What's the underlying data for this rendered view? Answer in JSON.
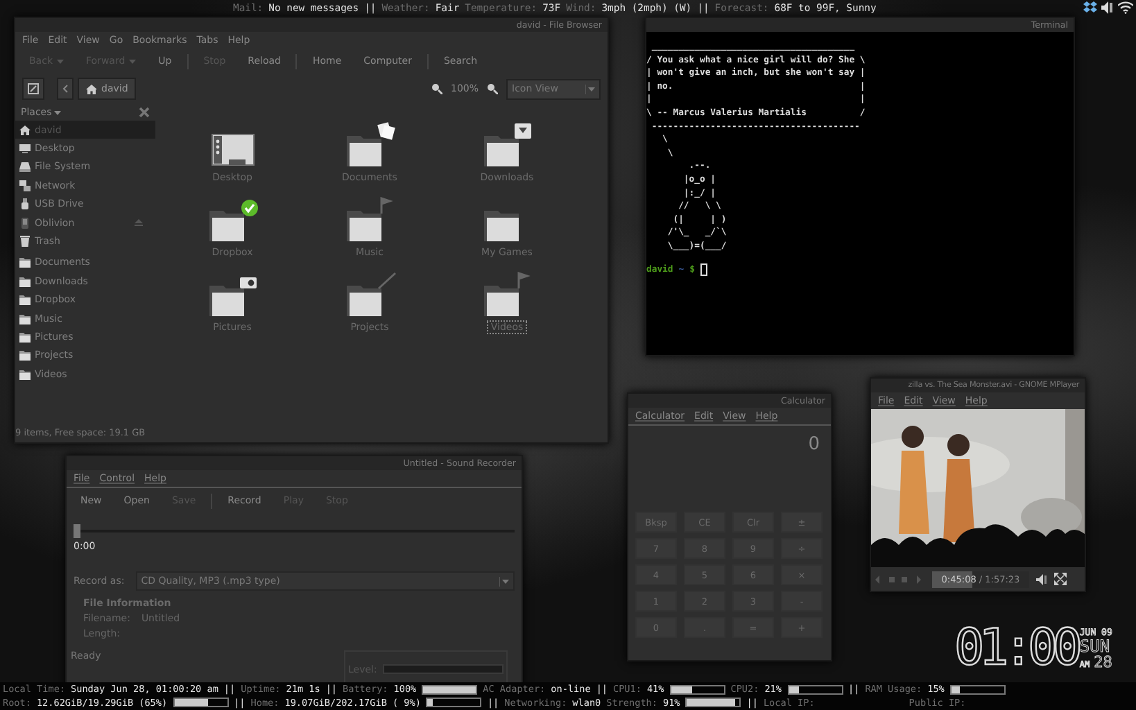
{
  "top_bar": {
    "items": [
      {
        "kind": "label",
        "text": "Mail:"
      },
      {
        "kind": "value",
        "text": "No new messages"
      },
      {
        "kind": "sep",
        "text": "||"
      },
      {
        "kind": "label",
        "text": "Weather:"
      },
      {
        "kind": "value",
        "text": "Fair"
      },
      {
        "kind": "label",
        "text": "Temperature:"
      },
      {
        "kind": "value",
        "text": "73F"
      },
      {
        "kind": "label",
        "text": "Wind:"
      },
      {
        "kind": "value",
        "text": "3mph (2mph) (W)"
      },
      {
        "kind": "sep",
        "text": "||"
      },
      {
        "kind": "label",
        "text": "Forecast:"
      },
      {
        "kind": "value",
        "text": "68F to 99F, Sunny"
      }
    ]
  },
  "file_browser": {
    "title": "david - File Browser",
    "menus": [
      "File",
      "Edit",
      "View",
      "Go",
      "Bookmarks",
      "Tabs",
      "Help"
    ],
    "toolbar": [
      {
        "label": "Back",
        "disabled": true,
        "kind": "dropdown"
      },
      {
        "label": "Forward",
        "disabled": true,
        "kind": "dropdown"
      },
      {
        "label": "Up",
        "disabled": false,
        "kind": "plain"
      },
      {
        "kind": "separator"
      },
      {
        "label": "Stop",
        "disabled": true,
        "kind": "plain"
      },
      {
        "label": "Reload",
        "disabled": false,
        "kind": "plain"
      },
      {
        "kind": "separator"
      },
      {
        "label": "Home",
        "disabled": false,
        "kind": "plain"
      },
      {
        "label": "Computer",
        "disabled": false,
        "kind": "plain"
      },
      {
        "kind": "separator"
      },
      {
        "label": "Search",
        "disabled": false,
        "kind": "plain"
      }
    ],
    "path": "david",
    "zoom": "100%",
    "view_mode": "Icon View",
    "sidebar": {
      "header": "Places",
      "items": [
        {
          "label": "david",
          "selected": true
        },
        {
          "label": "Desktop",
          "selected": false
        },
        {
          "label": "File System",
          "selected": false
        },
        {
          "label": "Network",
          "selected": false
        },
        {
          "label": "USB Drive",
          "selected": false
        },
        {
          "label": "Oblivion",
          "selected": false
        },
        {
          "label": "Trash",
          "selected": false
        },
        {
          "label": "Documents",
          "selected": false
        },
        {
          "label": "Downloads",
          "selected": false
        },
        {
          "label": "Dropbox",
          "selected": false
        },
        {
          "label": "Music",
          "selected": false
        },
        {
          "label": "Pictures",
          "selected": false
        },
        {
          "label": "Projects",
          "selected": false
        },
        {
          "label": "Videos",
          "selected": false
        }
      ]
    },
    "files": [
      {
        "label": "Desktop",
        "selected": false
      },
      {
        "label": "Documents",
        "selected": false
      },
      {
        "label": "Downloads",
        "selected": false
      },
      {
        "label": "Dropbox",
        "selected": false
      },
      {
        "label": "Music",
        "selected": false
      },
      {
        "label": "My Games",
        "selected": false
      },
      {
        "label": "Pictures",
        "selected": false
      },
      {
        "label": "Projects",
        "selected": false
      },
      {
        "label": "Videos",
        "selected": true
      }
    ],
    "status": "9 items, Free space: 19.1 GB"
  },
  "terminal": {
    "title": "Terminal",
    "output_lines": [
      " ______________________________________",
      "/ You ask what a nice girl will do? She \\",
      "| won't give an inch, but she won't say |",
      "| no.                                   |",
      "|                                       |",
      "\\ -- Marcus Valerius Martialis          /",
      " ---------------------------------------",
      "   \\",
      "    \\",
      "        .--.",
      "       |o_o |",
      "       |:_/ |",
      "      //   \\ \\",
      "     (|     | )",
      "    /'\\_   _/`\\",
      "    \\___)=(___/"
    ],
    "prompt": {
      "user": "david",
      "dir": "~",
      "symbol": "$"
    }
  },
  "sound_recorder": {
    "title": "Untitled - Sound Recorder",
    "menus": [
      "File",
      "Control",
      "Help"
    ],
    "toolbar": [
      {
        "label": "New",
        "disabled": false
      },
      {
        "label": "Open",
        "disabled": false
      },
      {
        "label": "Save",
        "disabled": true
      },
      {
        "label": "Record",
        "disabled": false
      },
      {
        "label": "Play",
        "disabled": true
      },
      {
        "label": "Stop",
        "disabled": true
      }
    ],
    "position": {
      "level": 0
    },
    "time": "0:00",
    "record_as_label": "Record as:",
    "record_as_value": "CD Quality, MP3 (.mp3 type)",
    "info_title": "File Information",
    "info": [
      {
        "label": "Filename:",
        "value": "Untitled"
      },
      {
        "label": "Length:"
      }
    ],
    "status": "Ready",
    "level_label": "Level:",
    "input_level": {
      "level": 0
    }
  },
  "calculator": {
    "title": "Calculator",
    "menus": [
      "Calculator",
      "Edit",
      "View",
      "Help"
    ],
    "display": "0",
    "keys": [
      "Bksp",
      "CE",
      "Clr",
      "±",
      "7",
      "8",
      "9",
      "÷",
      "4",
      "5",
      "6",
      "×",
      "1",
      "2",
      "3",
      "-",
      "0",
      ".",
      "=",
      "+"
    ]
  },
  "mplayer": {
    "title": "zilla vs. The Sea Monster.avi - GNOME MPlayer",
    "menus": [
      "File",
      "Edit",
      "View",
      "Help"
    ],
    "progress": {
      "level": 0.42
    },
    "elapsed": "0:45:08",
    "total": "/ 1:57:23"
  },
  "clock": {
    "time": "01:00",
    "month_day": "JUN 09",
    "weekday": "SUN",
    "meridiem": "AM",
    "day": "28"
  },
  "bottom_bar": {
    "lines": [
      [
        {
          "kind": "label",
          "text": "Local Time:"
        },
        {
          "kind": "value",
          "text": "Sunday Jun 28, 01:00:20 am"
        },
        {
          "kind": "sep",
          "text": "||"
        },
        {
          "kind": "label",
          "text": "Uptime:"
        },
        {
          "kind": "value",
          "text": "21m 1s"
        },
        {
          "kind": "sep",
          "text": "||"
        },
        {
          "kind": "label",
          "text": "Battery:"
        },
        {
          "kind": "value",
          "text": "100%"
        },
        {
          "kind": "bar",
          "level": 1
        },
        {
          "kind": "label",
          "text": "AC Adapter:"
        },
        {
          "kind": "value",
          "text": "on-line"
        },
        {
          "kind": "sep",
          "text": "||"
        },
        {
          "kind": "label",
          "text": "CPU1:"
        },
        {
          "kind": "value",
          "text": "41%"
        },
        {
          "kind": "bar",
          "level": 0.41
        },
        {
          "kind": "label",
          "text": "CPU2:"
        },
        {
          "kind": "value",
          "text": "21%"
        },
        {
          "kind": "bar",
          "level": 0.21
        },
        {
          "kind": "sep",
          "text": "||"
        },
        {
          "kind": "label",
          "text": "RAM Usage:"
        },
        {
          "kind": "value",
          "text": "15%"
        },
        {
          "kind": "bar",
          "level": 0.15
        }
      ],
      [
        {
          "kind": "label",
          "text": "Root:"
        },
        {
          "kind": "value",
          "text": "12.62GiB/19.29GiB (65%)"
        },
        {
          "kind": "bar",
          "level": 0.65
        },
        {
          "kind": "sep",
          "text": "||"
        },
        {
          "kind": "label",
          "text": "Home:"
        },
        {
          "kind": "value",
          "text": "19.07GiB/202.17GiB ( 9%)"
        },
        {
          "kind": "bar",
          "level": 0.09
        },
        {
          "kind": "sep",
          "text": "||"
        },
        {
          "kind": "label",
          "text": "Networking:"
        },
        {
          "kind": "value",
          "text": "wlan0"
        },
        {
          "kind": "label",
          "text": "Strength:"
        },
        {
          "kind": "value",
          "text": "91%"
        },
        {
          "kind": "bar",
          "level": 0.91
        },
        {
          "kind": "sep",
          "text": "||"
        },
        {
          "kind": "label",
          "text": "Local IP:"
        },
        {
          "kind": "gap"
        },
        {
          "kind": "label",
          "text": "Public IP:"
        }
      ]
    ]
  }
}
